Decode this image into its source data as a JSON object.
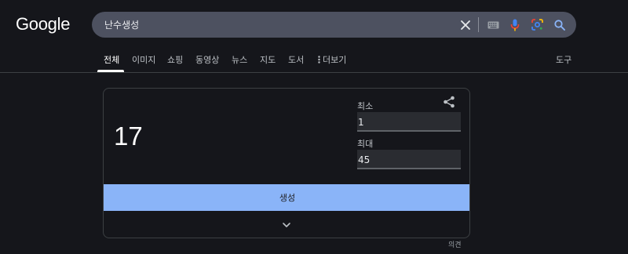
{
  "header": {
    "logo": "Google",
    "search_value": "난수생성",
    "icons": [
      "close-icon",
      "keyboard-icon",
      "mic-icon",
      "lens-icon",
      "search-icon"
    ]
  },
  "tabs": [
    {
      "label": "전체",
      "active": true
    },
    {
      "label": "이미지"
    },
    {
      "label": "쇼핑"
    },
    {
      "label": "동영상"
    },
    {
      "label": "뉴스"
    },
    {
      "label": "지도"
    },
    {
      "label": "도서"
    },
    {
      "label": "더보기"
    }
  ],
  "tools_label": "도구",
  "rng": {
    "result": "17",
    "min_label": "최소",
    "min_value": "1",
    "max_label": "최대",
    "max_value": "45",
    "generate_label": "생성"
  },
  "feedback_label": "의견",
  "colors": {
    "background": "#15161b",
    "search_bar": "#4d5160",
    "generate_button": "#8ab4f8",
    "mic_blue": "#4285f4",
    "mic_red": "#ea4335"
  }
}
